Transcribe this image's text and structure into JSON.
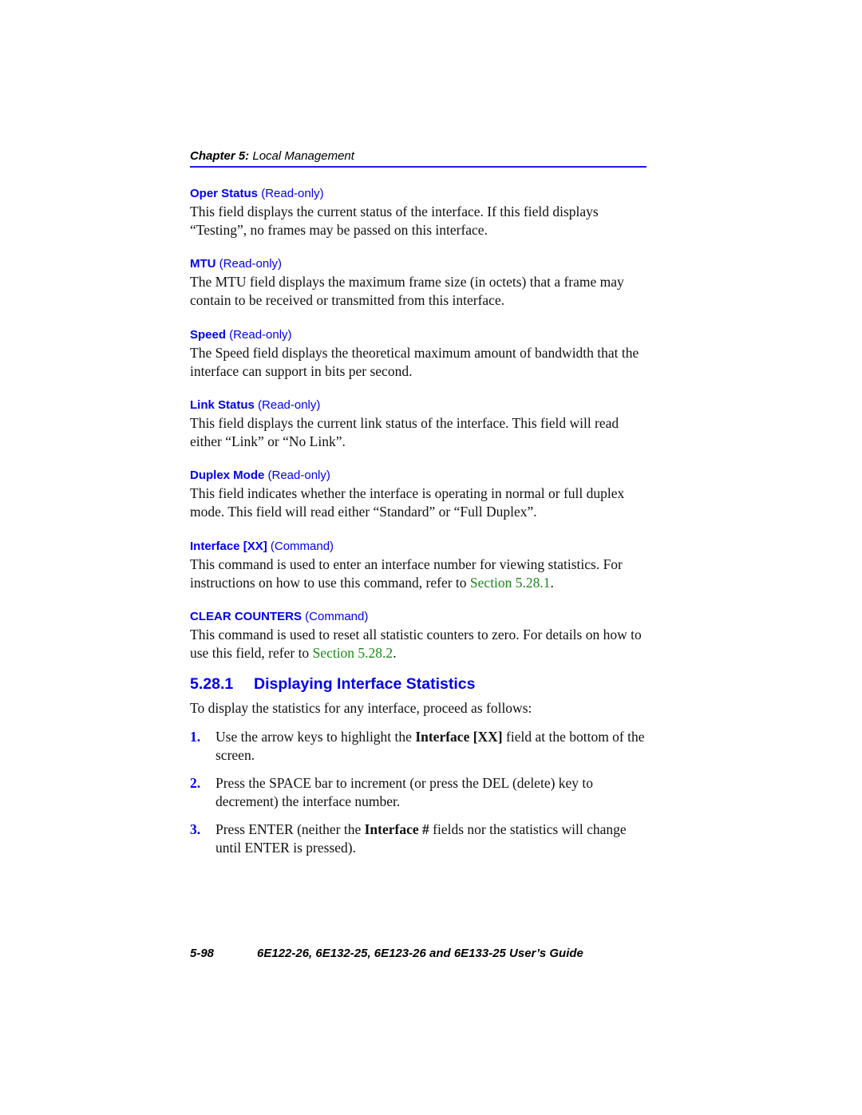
{
  "header": {
    "chapter_label": "Chapter 5:",
    "chapter_title": " Local Management"
  },
  "entries": [
    {
      "name": "Oper Status",
      "qualifier": " (Read-only)",
      "text": "This field displays the current status of the interface. If this field displays “Testing”, no frames may be passed on this interface."
    },
    {
      "name": "MTU",
      "qualifier": " (Read-only)",
      "text": "The MTU field displays the maximum frame size (in octets) that a frame may contain to be received or transmitted from this interface."
    },
    {
      "name": "Speed",
      "qualifier": " (Read-only)",
      "text": "The Speed field displays the theoretical maximum amount of bandwidth that the interface can support in bits per second."
    },
    {
      "name": "Link Status",
      "qualifier": " (Read-only)",
      "text": "This field displays the current link status of the interface. This field will read either “Link” or “No Link”."
    },
    {
      "name": "Duplex Mode",
      "qualifier": " (Read-only)",
      "text": "This field indicates whether the interface is operating in normal or full duplex mode. This field will read either “Standard” or “Full Duplex”."
    },
    {
      "name": "Interface [XX]",
      "qualifier": " (Command)",
      "text": "This command is used to enter an interface number for viewing statistics. For instructions on how to use this command, refer to ",
      "link": "Section 5.28.1",
      "after": "."
    },
    {
      "name": "CLEAR COUNTERS",
      "qualifier": " (Command)",
      "text": "This command is used to reset all statistic counters to zero. For details on how to use this field, refer to ",
      "link": "Section 5.28.2",
      "after": "."
    }
  ],
  "section": {
    "number": "5.28.1",
    "title": "Displaying Interface Statistics",
    "intro": "To display the statistics for any interface, proceed as follows:",
    "steps": [
      {
        "num": "1.",
        "before": "Use the arrow keys to highlight the ",
        "bold": "Interface [XX]",
        "after": " field at the bottom of the screen."
      },
      {
        "num": "2.",
        "before": "Press the SPACE bar to increment (or press the DEL (delete) key to decrement) the interface number.",
        "bold": "",
        "after": ""
      },
      {
        "num": "3.",
        "before": "Press ENTER (neither the ",
        "bold": "Interface #",
        "after": " fields nor the statistics will change until ENTER is pressed)."
      }
    ]
  },
  "footer": {
    "page": "5-98",
    "title": "6E122-26, 6E132-25, 6E123-26 and 6E133-25 User’s Guide"
  }
}
